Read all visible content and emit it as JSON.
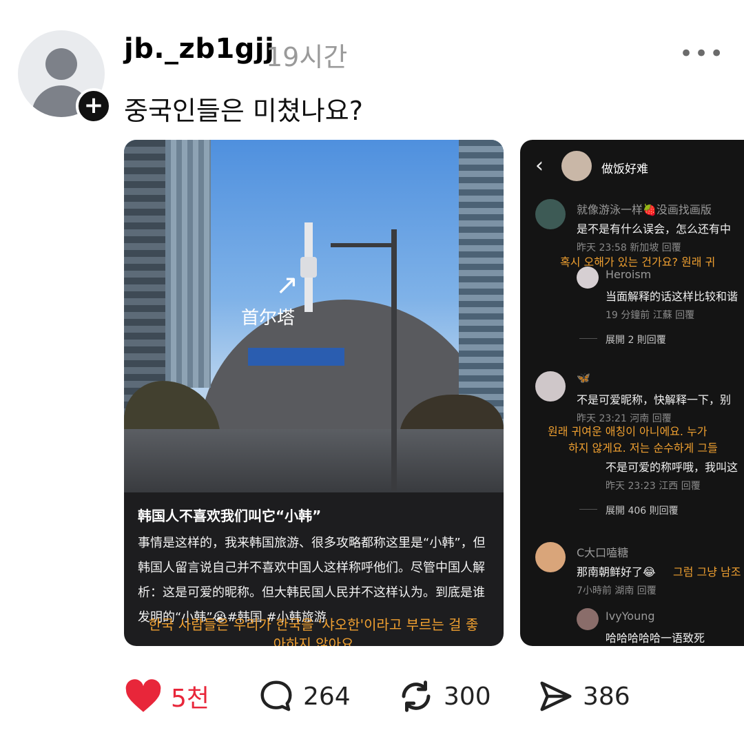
{
  "post": {
    "username": "jb._zb1gjj",
    "time": "19시간",
    "more_icon": "more-horizontal-icon",
    "text": "중국인들은 미쳤나요?"
  },
  "image1": {
    "photo_label": "首尔塔",
    "title": "韩国人不喜欢我们叫它“小韩”",
    "body": "事情是这样的，我来韩国旅游、很多攻略都称这里是“小韩”，但韩国人留言说自己并不喜欢中国人这样称呼他们。尽管中国人解析：这是可爱的昵称。但大韩民国人民并不这样认为。到底是谁发明的“小韩”😭#韩国 #小韩旅游",
    "overlay": "한국 사람들은 우리가 한국을 '샤오한'이라고 부르는 걸 좋아하지 않아요"
  },
  "image2": {
    "header_name": "做饭好难",
    "comments": [
      {
        "name": "就像游泳一样🍓没画找画版",
        "text": "是不是有什么误会，怎么还有中",
        "meta": "昨天 23:58 新加坡  回覆",
        "translation": "혹시 오해가 있는 건가요? 원래 귀"
      },
      {
        "name": "Heroism",
        "text": "当面解释的话这样比较和谐",
        "meta": "19 分鐘前 江蘇  回覆",
        "expand": "展開 2 則回覆"
      },
      {
        "name": "🦋",
        "text": "不是可爱昵称，快解释一下，别",
        "meta": "昨天 23:21 河南  回覆",
        "translation": "원래 귀여운 애칭이 아니에요. 누가",
        "translation2": "하지 않게요. 저는 순수하게 그들"
      },
      {
        "name": "",
        "text": "不是可爱的称呼哦，我叫这",
        "meta": "昨天 23:23 江西  回覆",
        "expand": "展開 406 則回覆"
      },
      {
        "name": "C大口嗑糖",
        "text": "那南朝鲜好了😂",
        "translation": "그럼 그냥 남조",
        "meta": "7小時前 湖南  回覆"
      },
      {
        "name": "IvyYoung",
        "text": "哈哈哈哈哈一语致死"
      }
    ]
  },
  "actions": {
    "like": "5천",
    "comment": "264",
    "repost": "300",
    "share": "386"
  },
  "colors": {
    "like": "#e8263a",
    "orange_subtitle": "#f0a030"
  }
}
